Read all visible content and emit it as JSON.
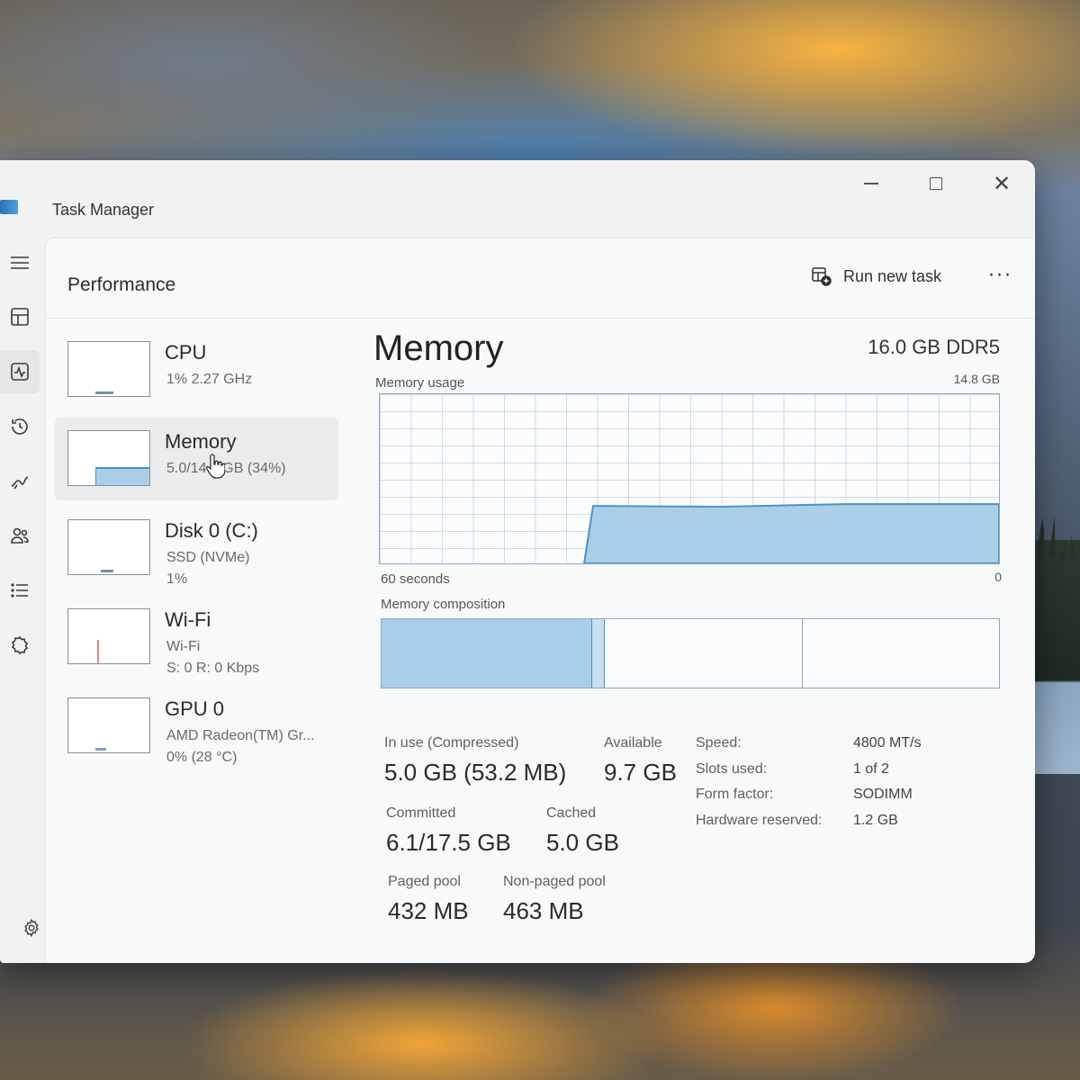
{
  "window": {
    "title": "Task Manager",
    "controls": {
      "minimize": "minimize-icon",
      "maximize": "maximize-icon",
      "close": "close-icon"
    }
  },
  "nav": {
    "items": [
      {
        "name": "hamburger-menu",
        "icon": "menu-icon"
      },
      {
        "name": "processes",
        "icon": "processes-icon"
      },
      {
        "name": "performance",
        "icon": "performance-icon",
        "active": true
      },
      {
        "name": "app-history",
        "icon": "history-icon"
      },
      {
        "name": "startup-apps",
        "icon": "startup-icon"
      },
      {
        "name": "users",
        "icon": "users-icon"
      },
      {
        "name": "details",
        "icon": "details-icon"
      },
      {
        "name": "services",
        "icon": "services-icon"
      },
      {
        "name": "settings",
        "icon": "gear-icon"
      }
    ]
  },
  "header": {
    "page_title": "Performance",
    "run_task_label": "Run new task",
    "more_label": "···"
  },
  "resources": [
    {
      "name": "CPU",
      "line1": "1%  2.27 GHz",
      "line2": ""
    },
    {
      "name": "Memory",
      "line1": "5.0/14.8 GB (34%)",
      "line2": "",
      "selected": true,
      "usage_fraction": 0.34
    },
    {
      "name": "Disk 0 (C:)",
      "line1": "SSD (NVMe)",
      "line2": "1%"
    },
    {
      "name": "Wi-Fi",
      "line1": "Wi-Fi",
      "line2": "S: 0  R: 0 Kbps"
    },
    {
      "name": "GPU 0",
      "line1": "AMD Radeon(TM) Gr...",
      "line2": "0%  (28 °C)"
    }
  ],
  "memory": {
    "title": "Memory",
    "spec": "16.0 GB DDR5",
    "usage_label": "Memory usage",
    "usage_max": "14.8 GB",
    "time_label": "60 seconds",
    "usage_min": "0",
    "composition_label": "Memory composition",
    "usage_history_fraction": {
      "start_point": 0.33,
      "level": 0.34
    },
    "composition_fractions": {
      "in_use": 0.34,
      "modified": 0.02,
      "standby": 0.32
    },
    "stats": {
      "in_use_label": "In use (Compressed)",
      "in_use_value": "5.0 GB (53.2 MB)",
      "available_label": "Available",
      "available_value": "9.7 GB",
      "committed_label": "Committed",
      "committed_value": "6.1/17.5 GB",
      "cached_label": "Cached",
      "cached_value": "5.0 GB",
      "paged_pool_label": "Paged pool",
      "paged_pool_value": "432 MB",
      "nonpaged_pool_label": "Non-paged pool",
      "nonpaged_pool_value": "463 MB"
    },
    "props": [
      {
        "key": "Speed:",
        "value": "4800 MT/s"
      },
      {
        "key": "Slots used:",
        "value": "1 of 2"
      },
      {
        "key": "Form factor:",
        "value": "SODIMM"
      },
      {
        "key": "Hardware reserved:",
        "value": "1.2 GB"
      }
    ]
  },
  "colors": {
    "memory_fill": "#a9cfe8",
    "memory_line": "#4f8fc2",
    "graph_border": "#8aa9c6"
  }
}
